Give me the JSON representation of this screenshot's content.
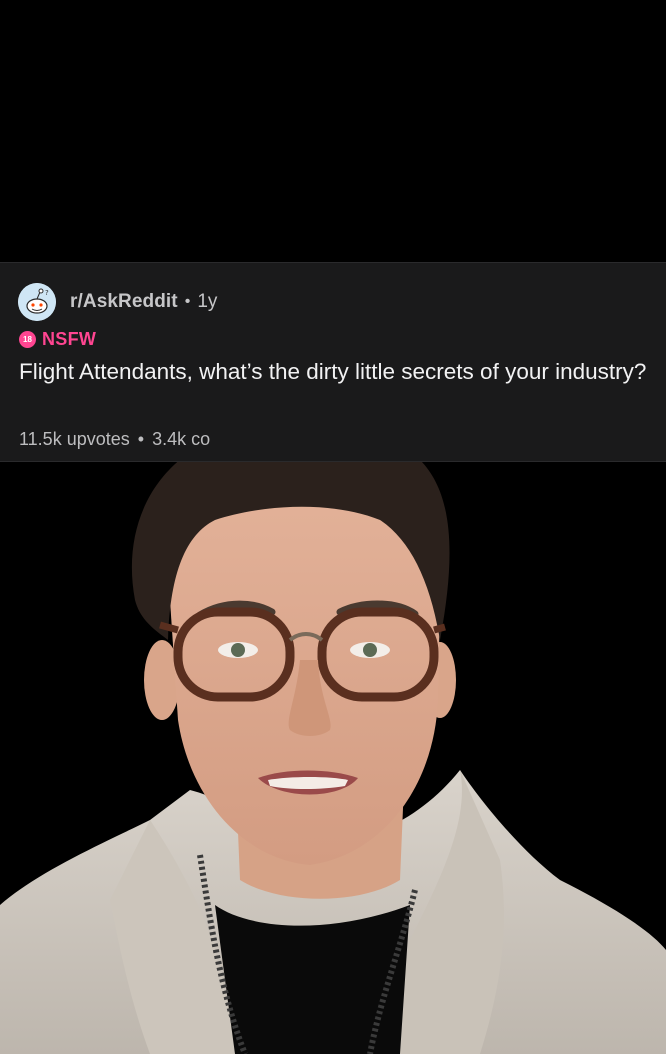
{
  "post": {
    "subreddit": "r/AskReddit",
    "separator": "•",
    "age": "1y",
    "nsfw_badge_text": "18",
    "nsfw_label": "NSFW",
    "title": "Flight Attendants, what’s the dirty little secrets of your industry?",
    "upvotes": "11.5k upvotes",
    "comments": "3.4k co"
  },
  "colors": {
    "background": "#000000",
    "card_background": "#1a1a1b",
    "nsfw_accent": "#ff4591",
    "title_text": "#f2f2f3",
    "meta_text": "#c6c6c8"
  },
  "icons": {
    "subreddit_avatar": "snoo-avatar-icon",
    "nsfw": "nsfw-18-icon"
  }
}
